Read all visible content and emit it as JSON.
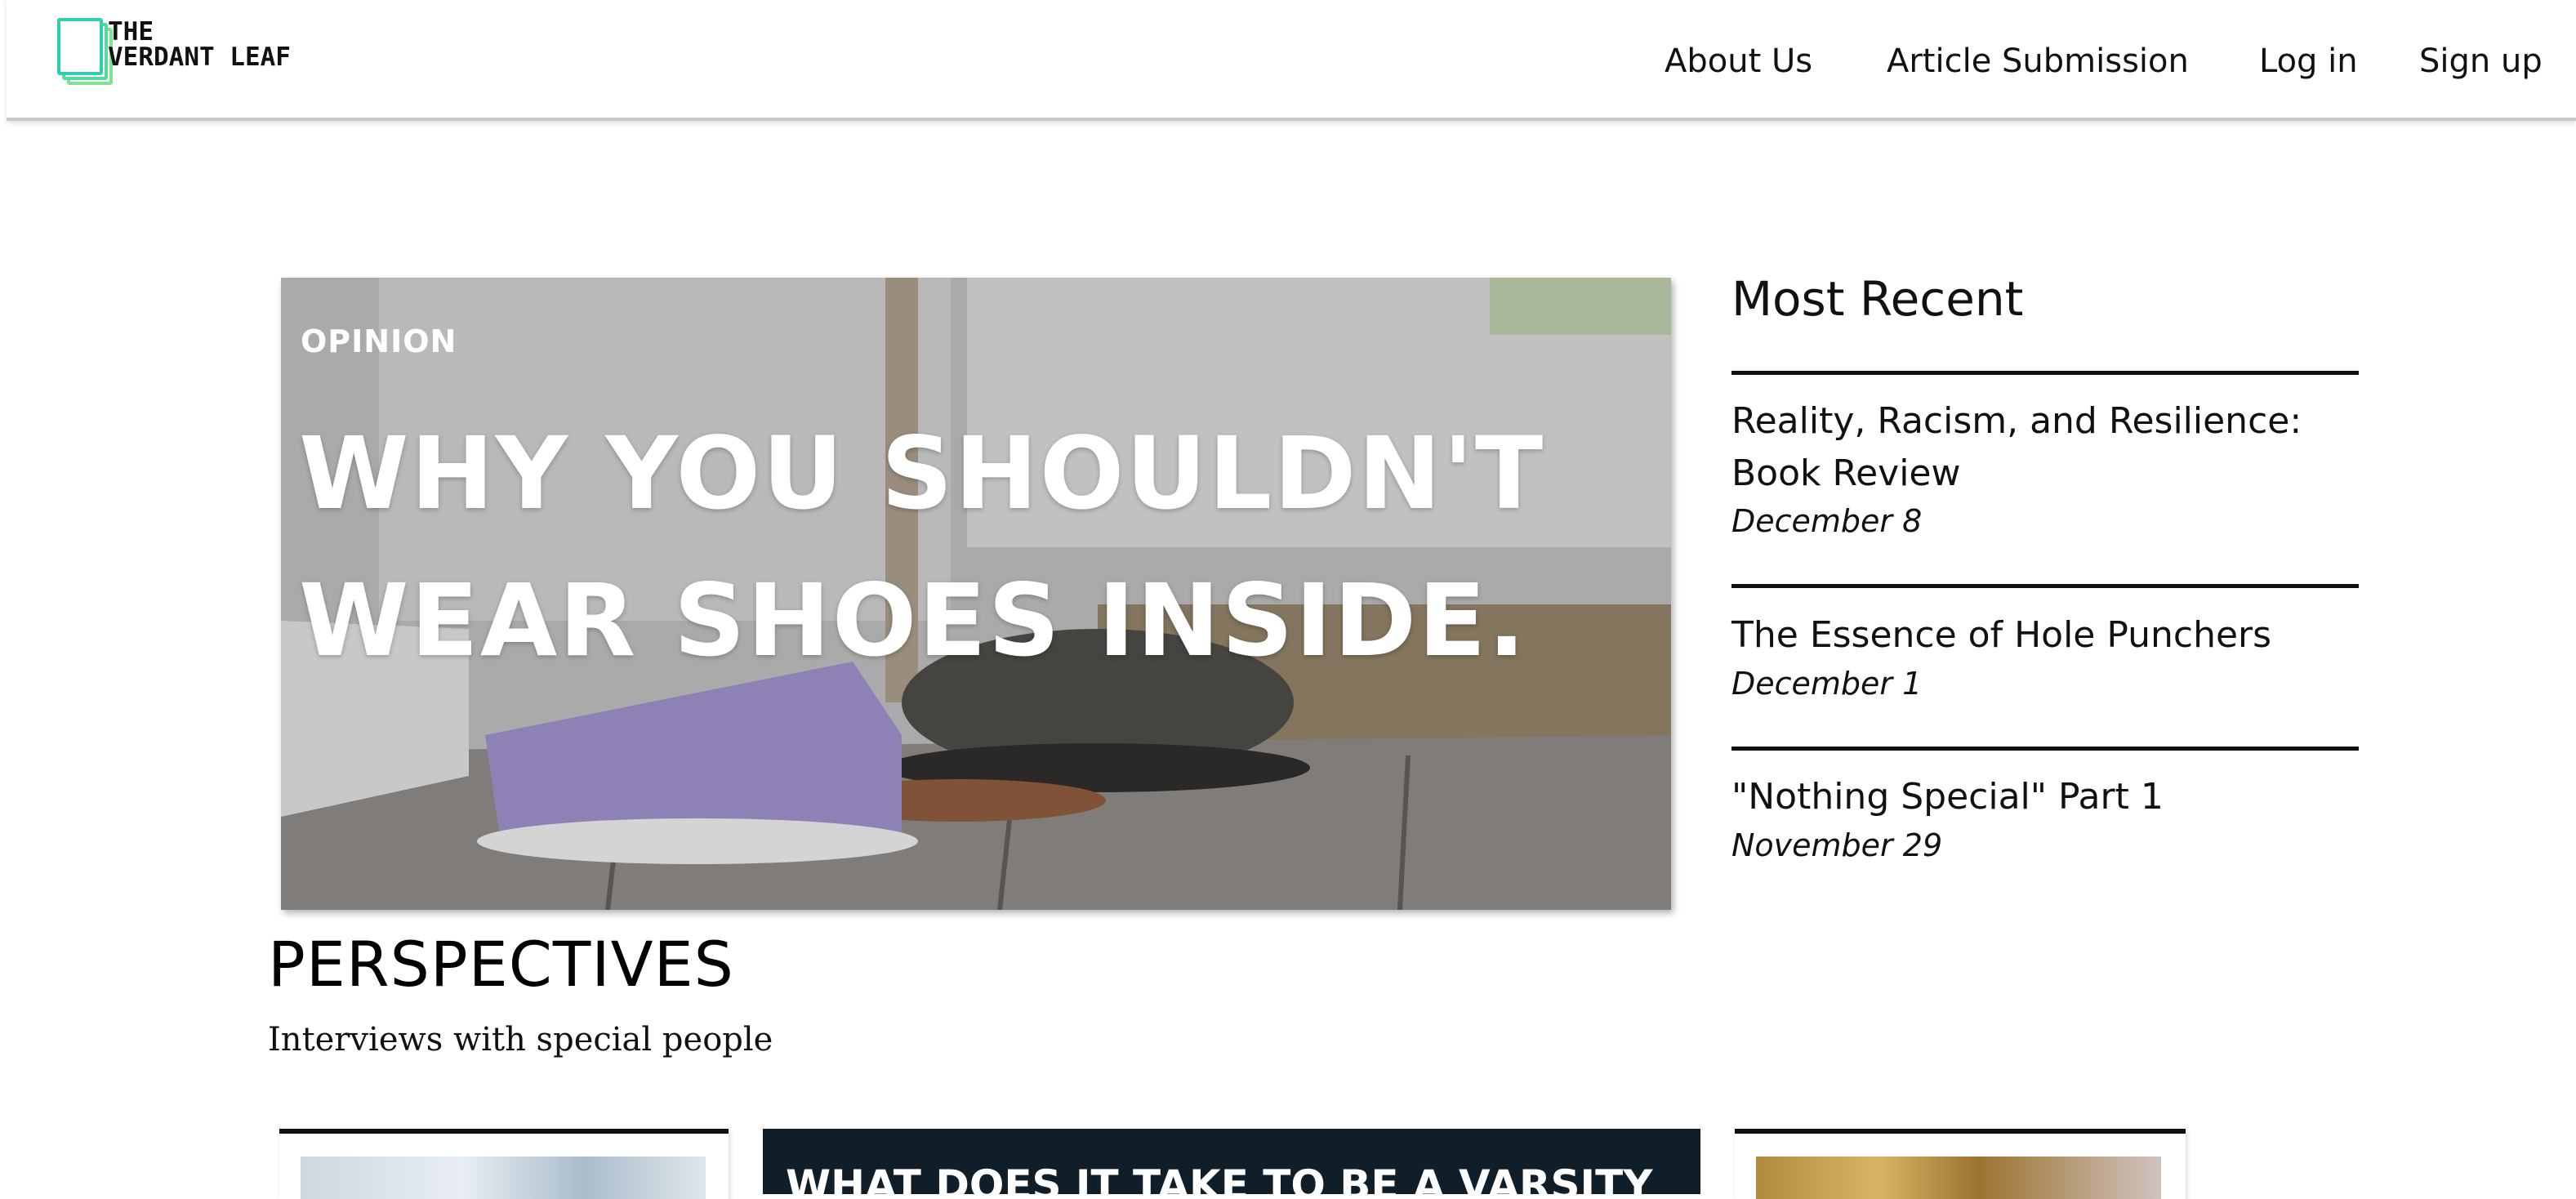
{
  "header": {
    "logo": {
      "line1": "THE",
      "line2": "VERDANT LEAF"
    },
    "nav": [
      "About Us",
      "Article Submission",
      "Log in",
      "Sign up"
    ]
  },
  "hero": {
    "category": "OPINION",
    "title_line1": "WHY YOU SHOULDN'T",
    "title_line2": "WEAR SHOES INSIDE."
  },
  "most_recent": {
    "heading": "Most Recent",
    "items": [
      {
        "title_line1": "Reality, Racism, and Resilience:",
        "title_line2": "Book Review",
        "date": "December 8"
      },
      {
        "title_line1": "The Essence of Hole Punchers",
        "title_line2": "",
        "date": "December 1"
      },
      {
        "title_line1": "\"Nothing Special\" Part 1",
        "title_line2": "",
        "date": "November 29"
      }
    ]
  },
  "perspectives": {
    "title": "PERSPECTIVES",
    "subtitle": "Interviews with special people"
  },
  "cards": [
    {
      "title": ""
    },
    {
      "title": "WHAT DOES IT TAKE TO BE A VARSITY"
    },
    {
      "title": ""
    }
  ]
}
